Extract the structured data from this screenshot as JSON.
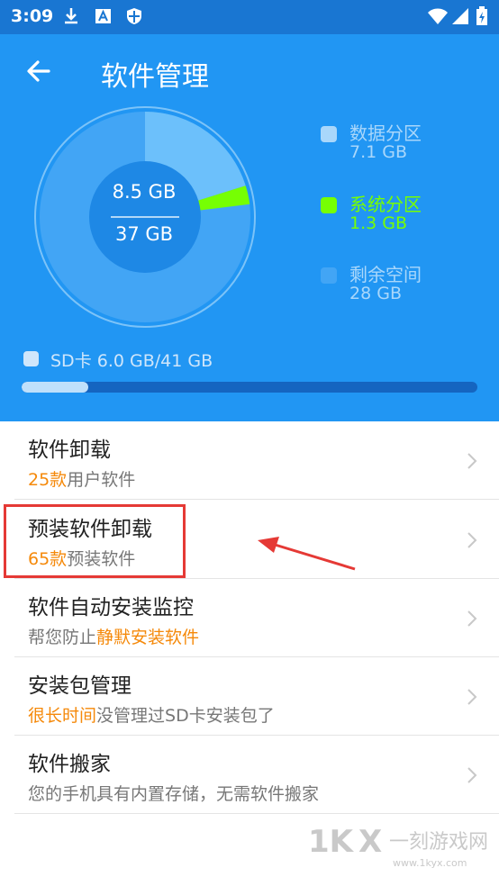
{
  "status_bar": {
    "time": "3:09"
  },
  "header": {
    "title": "软件管理"
  },
  "storage": {
    "used": "8.5 GB",
    "total": "37 GB",
    "legend": [
      {
        "name": "数据分区",
        "value": "7.1 GB",
        "color": "#6cc0fb"
      },
      {
        "name": "系统分区",
        "value": "1.3 GB",
        "color": "#76ff03"
      },
      {
        "name": "剩余空间",
        "value": "28 GB",
        "color": "#42a5f5"
      }
    ],
    "sd_card": "SD卡 6.0 GB/41 GB",
    "sd_fill_fraction": 0.146
  },
  "list": [
    {
      "title": "软件卸载",
      "highlight": "25款",
      "rest": "用户软件"
    },
    {
      "title": "预装软件卸载",
      "highlight": "65款",
      "rest": "预装软件"
    },
    {
      "title": "软件自动安装监控",
      "prefix": "帮您防止",
      "highlight": "静默安装软件"
    },
    {
      "title": "安装包管理",
      "highlight": "很长时间",
      "rest": "没管理过SD卡安装包了"
    },
    {
      "title": "软件搬家",
      "plain": "您的手机具有内置存储，无需软件搬家"
    }
  ],
  "watermark": {
    "text": "一刻游戏网",
    "url": "www.1kyx.com"
  }
}
